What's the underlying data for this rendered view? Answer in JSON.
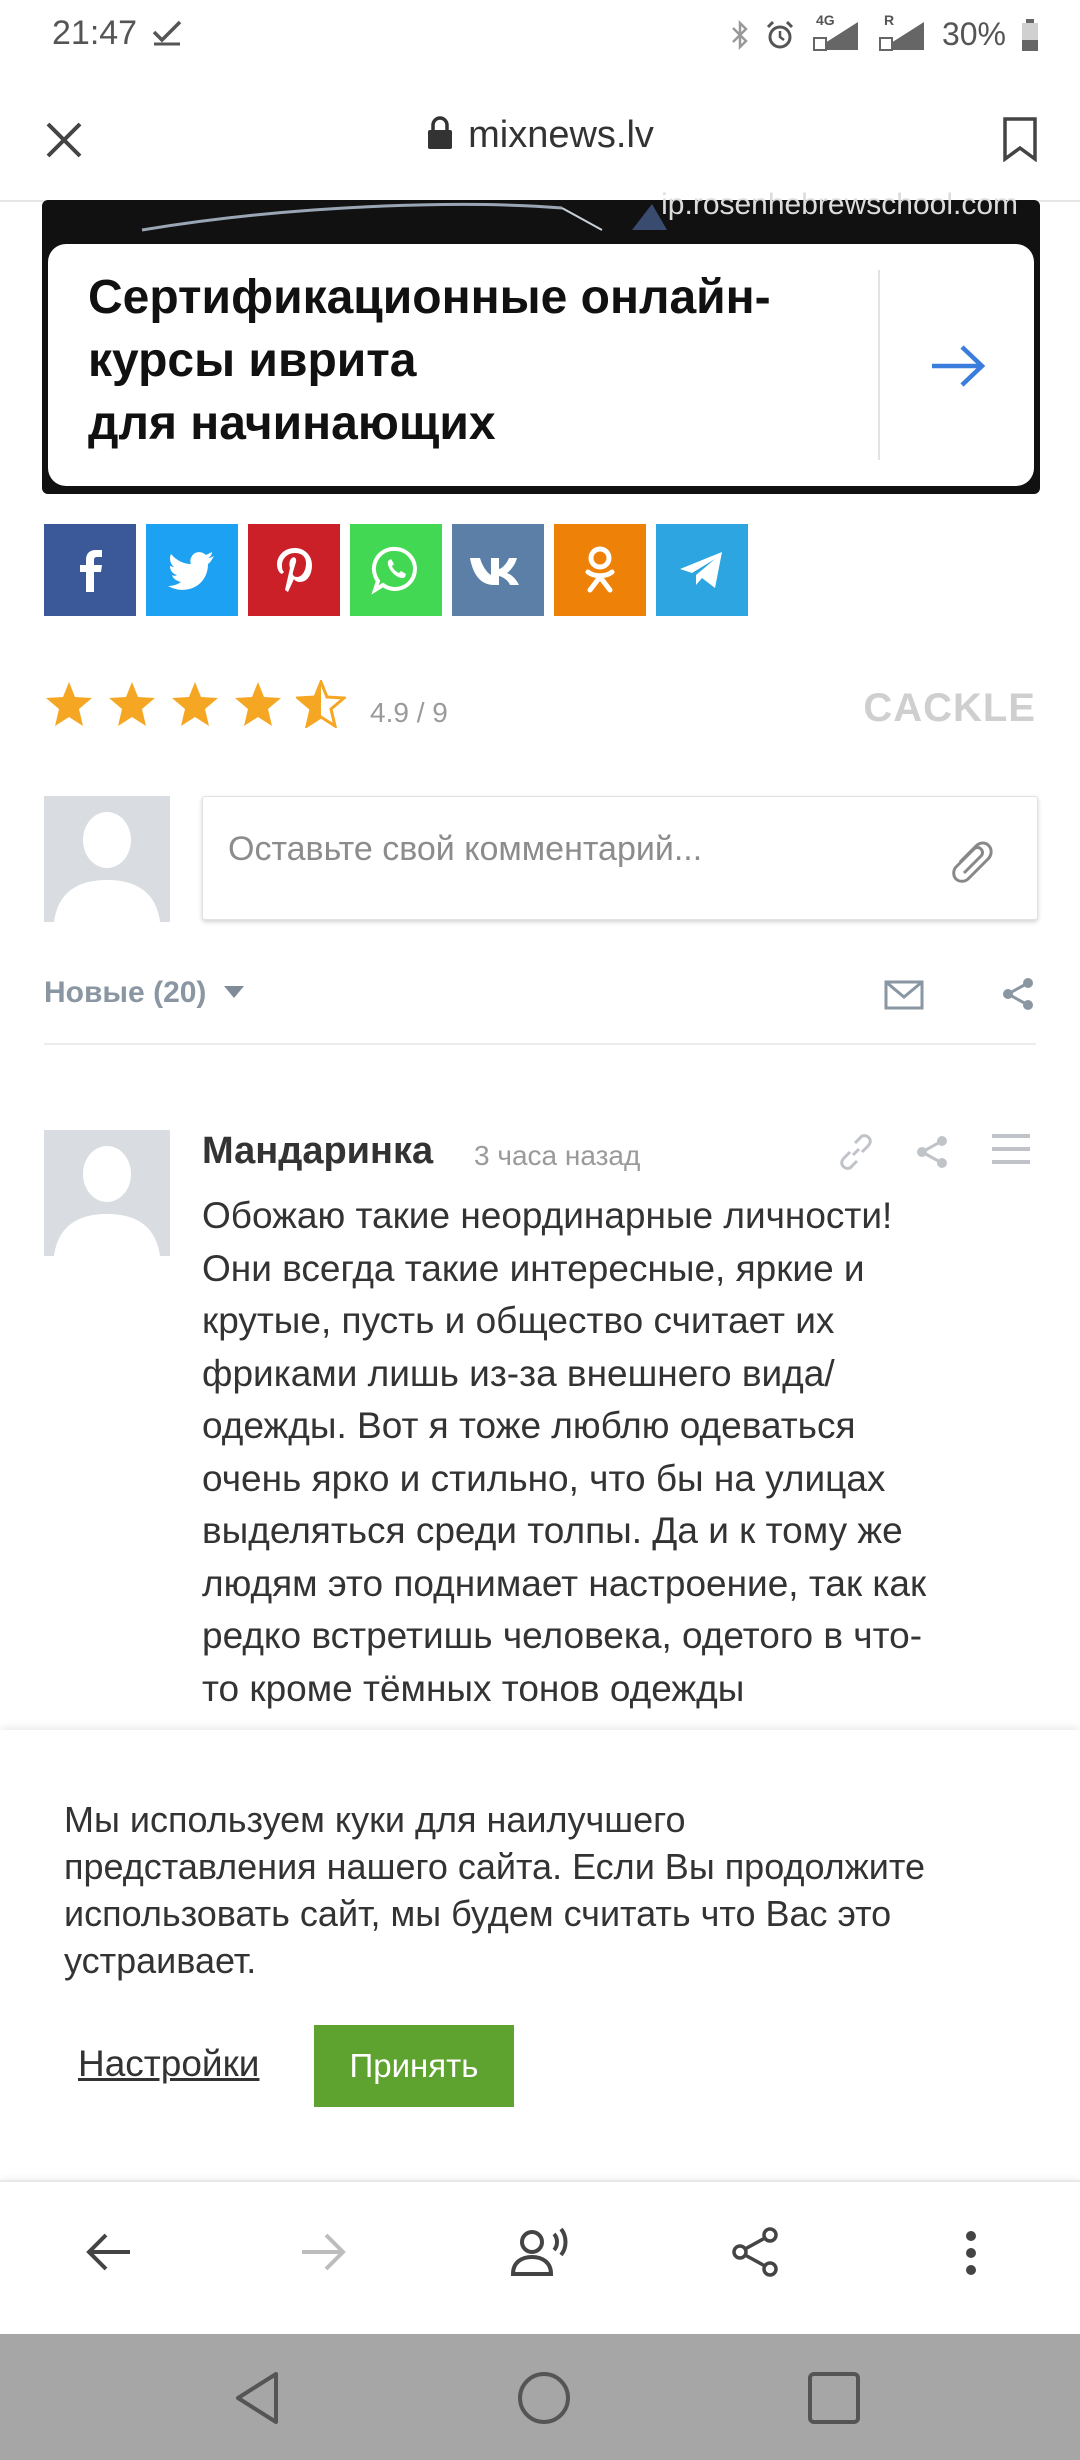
{
  "status_bar": {
    "time": "21:47",
    "net_4g": "4G",
    "net_r": "R",
    "battery": "30%"
  },
  "toolbar": {
    "url": "mixnews.lv"
  },
  "ad": {
    "domain": "ip.rosenhebrewschool.com",
    "title_line1": "Сертификационные онлайн-",
    "title_line2": "курсы иврита",
    "title_line3": "для начинающих",
    "accent": "#3b7ddd"
  },
  "share": {
    "buttons": [
      {
        "name": "facebook",
        "color": "#3b5998"
      },
      {
        "name": "twitter",
        "color": "#1da1f2"
      },
      {
        "name": "pinterest",
        "color": "#cb2027"
      },
      {
        "name": "whatsapp",
        "color": "#43d854"
      },
      {
        "name": "vk",
        "color": "#5b7fa6"
      },
      {
        "name": "odnoklassniki",
        "color": "#ee8208"
      },
      {
        "name": "telegram",
        "color": "#2ca5e0"
      }
    ]
  },
  "rating": {
    "value": 4.9,
    "display": "4.9 / 9",
    "stars": 4.5,
    "brand": "CACKLE",
    "star_color": "#f5a623"
  },
  "comment_form": {
    "placeholder": "Оставьте свой комментарий..."
  },
  "comments_header": {
    "sort_label": "Новые (20)"
  },
  "comments": [
    {
      "author": "Мандаринка",
      "time": "3 часа назад",
      "lines": [
        "Обожаю такие неординарные личности!",
        "Они всегда такие интересные, яркие и",
        "крутые, пусть и общество считает их",
        "фриками лишь из-за внешнего вида/",
        "одежды. Вот я тоже люблю одеваться",
        "очень ярко и стильно, что бы на улицах",
        "выделяться среди толпы. Да и к тому же",
        "людям это поднимает настроение, так как",
        "редко встретишь человека, одетого в что-",
        "то кроме тёмных тонов одежды"
      ]
    }
  ],
  "cookie": {
    "lines": [
      "Мы используем куки для наилучшего",
      "представления нашего сайта. Если Вы продолжите",
      "использовать сайт, мы будем считать что Вас это",
      "устраивает."
    ],
    "settings_label": "Настройки",
    "accept_label": "Принять",
    "accent": "#5ea230"
  }
}
